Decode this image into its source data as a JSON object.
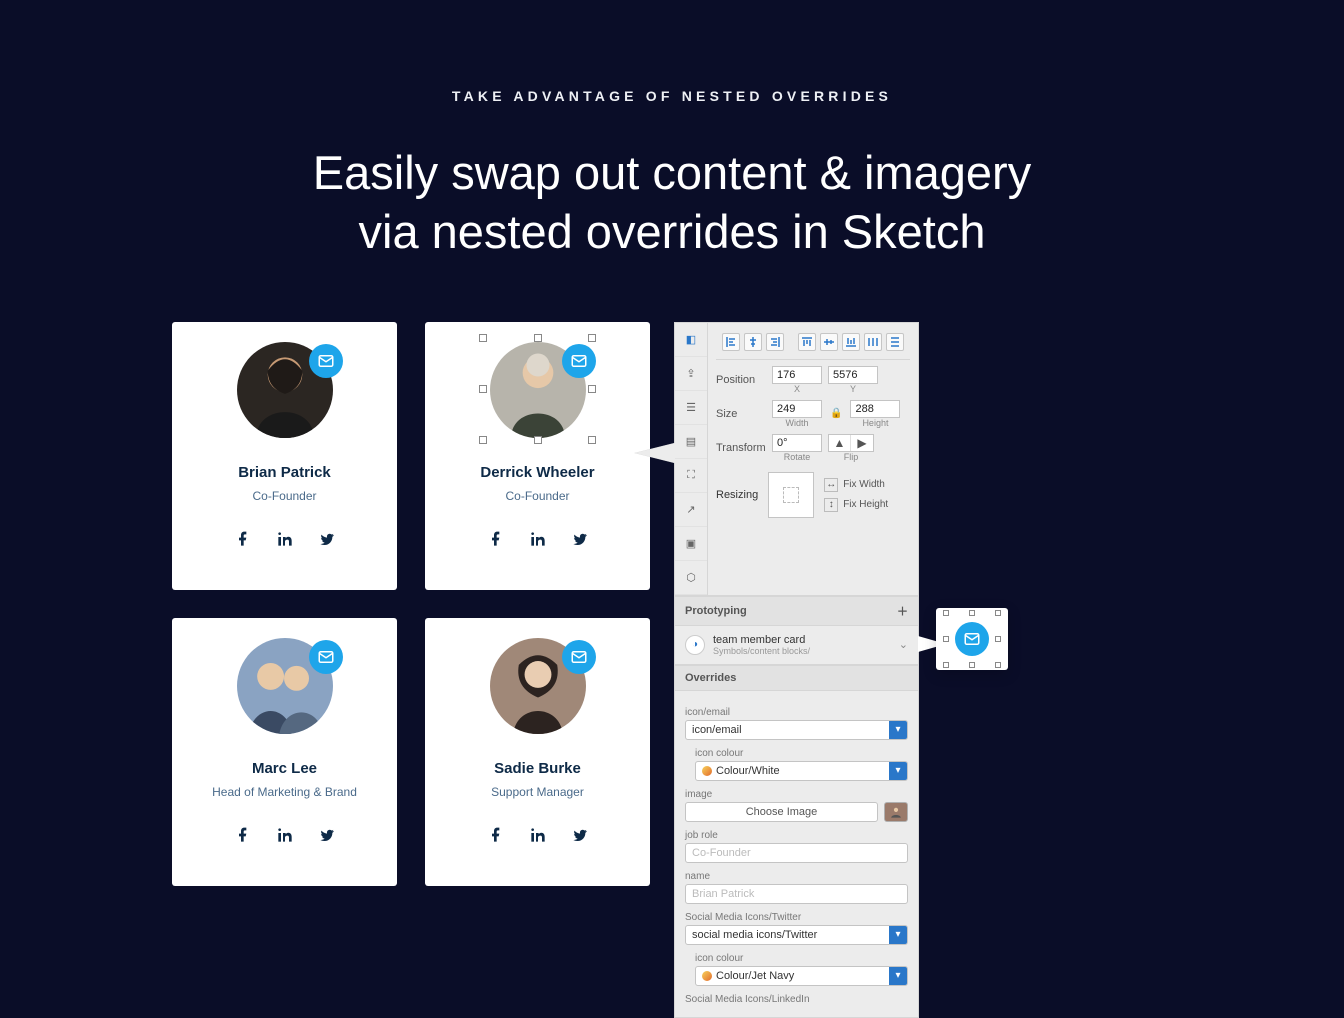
{
  "eyebrow": "TAKE ADVANTAGE OF NESTED OVERRIDES",
  "headline_l1": "Easily swap out content & imagery",
  "headline_l2": "via nested overrides in Sketch",
  "cards": [
    {
      "name": "Brian Patrick",
      "role": "Co-Founder",
      "avatar_bg": "#2b2622"
    },
    {
      "name": "Derrick Wheeler",
      "role": "Co-Founder",
      "avatar_bg": "#b7b4ab",
      "selected": true
    },
    {
      "name": "Marc Lee",
      "role": "Head of Marketing & Brand",
      "avatar_bg": "#8aa3c2"
    },
    {
      "name": "Sadie Burke",
      "role": "Support Manager",
      "avatar_bg": "#a08878"
    }
  ],
  "inspector": {
    "position": {
      "label": "Position",
      "x": "176",
      "y": "5576",
      "xl": "X",
      "yl": "Y"
    },
    "size": {
      "label": "Size",
      "w": "249",
      "h": "288",
      "wl": "Width",
      "hl": "Height"
    },
    "transform": {
      "label": "Transform",
      "rotate": "0°",
      "rl": "Rotate",
      "fl": "Flip"
    },
    "resizing": {
      "label": "Resizing",
      "fix_w": "Fix Width",
      "fix_h": "Fix Height"
    },
    "prototyping": "Prototyping",
    "symbol": {
      "name": "team member card",
      "path": "Symbols/content blocks/"
    },
    "overrides_h": "Overrides",
    "ov": {
      "icon_email_lbl": "icon/email",
      "icon_email_val": "icon/email",
      "icon_colour_lbl": "icon colour",
      "icon_colour_val": "Colour/White",
      "image_lbl": "image",
      "choose_image": "Choose Image",
      "job_role_lbl": "job role",
      "job_role_ph": "Co-Founder",
      "name_lbl": "name",
      "name_ph": "Brian Patrick",
      "sm_twitter_lbl": "Social Media Icons/Twitter",
      "sm_twitter_val": "social media icons/Twitter",
      "sm_twitter_colour_lbl": "icon colour",
      "sm_twitter_colour_val": "Colour/Jet Navy",
      "sm_linkedin_lbl": "Social Media Icons/LinkedIn"
    }
  }
}
